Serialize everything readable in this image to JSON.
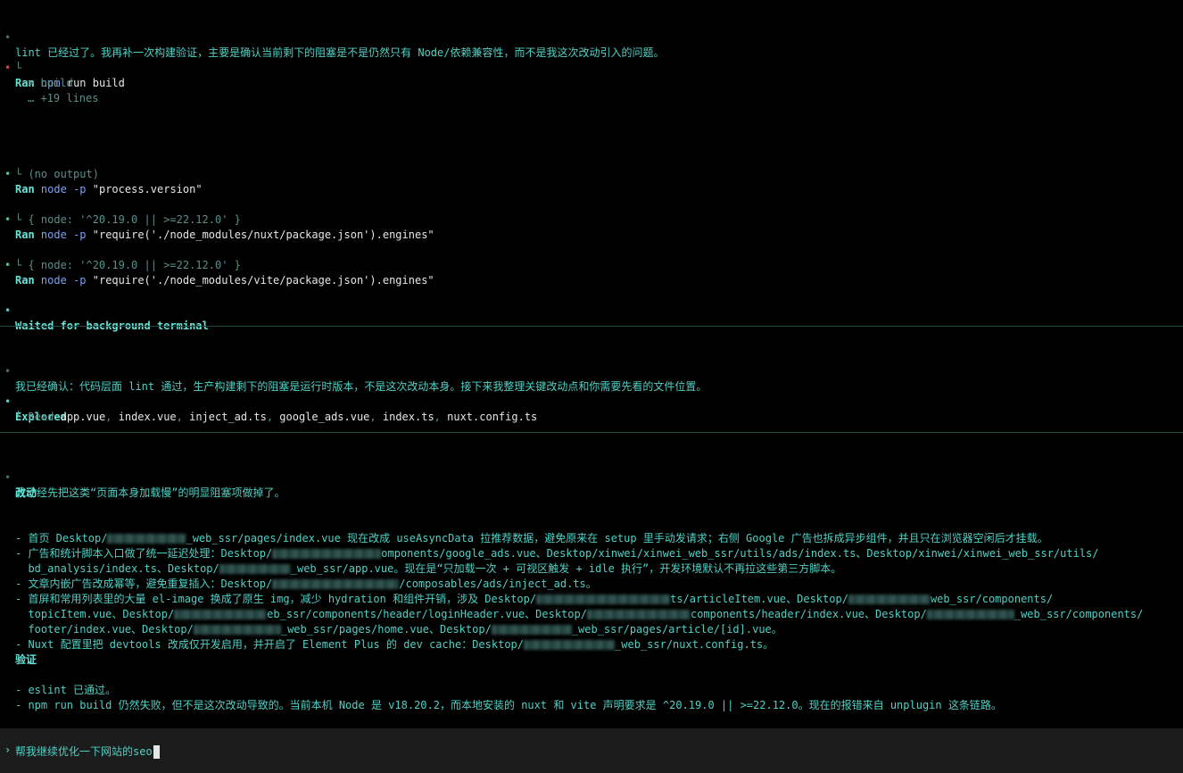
{
  "messages": {
    "m1": "lint 已经过了。我再补一次构建验证，主要是确认当前剩下的阻塞是不是仍然只有 Node/依赖兼容性，而不是我这次改动引入的问题。",
    "ran_label": "Ran",
    "cmd_build_prog": "npm",
    "cmd_build_args": "run build",
    "build_out1": "> build",
    "build_out2": "… +19 lines",
    "cmd2_prog": "node",
    "cmd2_flag": "-p",
    "cmd2_arg": "\"process.version\"",
    "cmd2_out": "(no output)",
    "cmd3_arg": "\"require('./node_modules/nuxt/package.json').engines\"",
    "cmd3_out": "{ node: '^20.19.0 || >=22.12.0' }",
    "cmd4_arg": "\"require('./node_modules/vite/package.json').engines\"",
    "cmd4_out": "{ node: '^20.19.0 || >=22.12.0' }",
    "waited": "Waited for background terminal",
    "m2": "我已经确认：代码层面 lint 通过，生产构建剩下的阻塞是运行时版本，不是这次改动本身。接下来我整理关键改动点和你需要先看的文件位置。",
    "explored": "Explored",
    "read_label": "Read",
    "read_files": [
      "app.vue",
      "index.vue",
      "inject_ad.ts",
      "google_ads.vue",
      "index.ts",
      "nuxt.config.ts"
    ],
    "m3": "我已经先把这类“页面本身加载慢”的明显阻塞项做掉了。",
    "h_changes": "改动",
    "c1a": "- 首页 Desktop/",
    "c1b": "_web_ssr/pages/index.vue 现在改成 useAsyncData 拉推荐数据，避免原来在 setup 里手动发请求；右侧 Google 广告也拆成异步组件，并且只在浏览器空闲后才挂载。",
    "c2a": "- 广告和统计脚本入口做了统一延迟处理：Desktop/",
    "c2b": "omponents/google_ads.vue、Desktop/xinwei/xinwei_web_ssr/utils/ads/index.ts、Desktop/xinwei/xinwei_web_ssr/utils/",
    "c2c": "  bd_analysis/index.ts、Desktop/",
    "c2d": "_web_ssr/app.vue。现在是“只加载一次 + 可视区触发 + idle 执行”，开发环境默认不再拉这些第三方脚本。",
    "c3a": "- 文章内嵌广告改成幂等，避免重复插入：Desktop/",
    "c3b": "/composables/ads/inject_ad.ts。",
    "c4a": "- 首屏和常用列表里的大量 el-image 换成了原生 img，减少 hydration 和组件开销，涉及 Desktop/",
    "c4b": "ts/articleItem.vue、Desktop/",
    "c4c": "web_ssr/components/",
    "c4d": "  topicItem.vue、Desktop/",
    "c4e": "eb_ssr/components/header/loginHeader.vue、Desktop/",
    "c4f": "components/header/index.vue、Desktop/",
    "c4g": "_web_ssr/components/",
    "c4h": "  footer/index.vue、Desktop/",
    "c4i": "_web_ssr/pages/home.vue、Desktop/",
    "c4j": "_web_ssr/pages/article/[id].vue。",
    "c5a": "- Nuxt 配置里把 devtools 改成仅开发启用，并开启了 Element Plus 的 dev cache：Desktop/",
    "c5b": "_web_ssr/nuxt.config.ts。",
    "h_verify": "验证",
    "v1": "- eslint 已通过。",
    "v2": "- npm run build 仍然失败，但不是这次改动导致的。当前本机 Node 是 v18.20.2，而本地安装的 nuxt 和 vite 声明要求是 ^20.19.0 || >=22.12.0。现在的报错来自 unplugin 这条链路。"
  },
  "input": {
    "prompt_symbol": "›",
    "value": "帮我继续优化一下网站的seo"
  },
  "colors": {
    "background": "#000000",
    "text": "#4fd1c5",
    "input_bar": "#1c1c1c",
    "error_dot": "#e0443a",
    "success_dot": "#3ccf8e"
  }
}
